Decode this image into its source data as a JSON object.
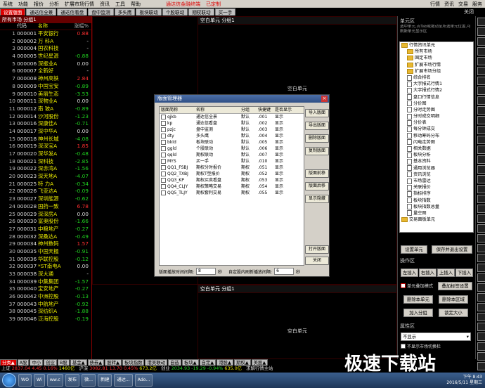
{
  "menubar": {
    "items": [
      "系统",
      "功能",
      "报价",
      "分析",
      "扩展市场行情",
      "资讯",
      "工具",
      "帮助"
    ],
    "alert": "通达信金融终端",
    "alert2": "已定制",
    "right": [
      "行情",
      "资讯",
      "交易",
      "服务"
    ]
  },
  "tabs": [
    "设置版面",
    "通达信全景",
    "通达信看盘",
    "盘中监测",
    "多头鹰",
    "板块联动",
    "个股联动",
    "期权联动",
    "买一手"
  ],
  "close_label": "关闭",
  "stocklist": {
    "header": "所有市场 分组1",
    "col_code": "代码",
    "col_name": "名称",
    "col_chg": "涨幅%",
    "rows": [
      {
        "no": "1",
        "code": "000001",
        "name": "平安银行",
        "chg": "0.88",
        "dir": "up"
      },
      {
        "no": "2",
        "code": "000002",
        "name": "万 科A",
        "chg": "-",
        "dir": "fl"
      },
      {
        "no": "3",
        "code": "000004",
        "name": "国农科技",
        "chg": "-",
        "dir": "fl"
      },
      {
        "no": "4",
        "code": "000005",
        "name": "世纪星源",
        "chg": "-0.88",
        "dir": "dn"
      },
      {
        "no": "5",
        "code": "000006",
        "name": "深振业A",
        "chg": "0.00",
        "dir": "fl"
      },
      {
        "no": "6",
        "code": "000007",
        "name": "全新好",
        "chg": "-",
        "dir": "fl"
      },
      {
        "no": "7",
        "code": "000008",
        "name": "神州高铁",
        "chg": "2.84",
        "dir": "up"
      },
      {
        "no": "8",
        "code": "000009",
        "name": "中国宝安",
        "chg": "-0.89",
        "dir": "dn"
      },
      {
        "no": "9",
        "code": "000010",
        "name": "美丽生态",
        "chg": "-3.53",
        "dir": "dn"
      },
      {
        "no": "10",
        "code": "000011",
        "name": "深物业A",
        "chg": "0.00",
        "dir": "fl"
      },
      {
        "no": "11",
        "code": "000012",
        "name": "南 玻A",
        "chg": "-0.89",
        "dir": "dn"
      },
      {
        "no": "12",
        "code": "000014",
        "name": "沙河股份",
        "chg": "-1.23",
        "dir": "dn"
      },
      {
        "no": "13",
        "code": "000016",
        "name": "深康佳A",
        "chg": "-0.71",
        "dir": "dn"
      },
      {
        "no": "14",
        "code": "000017",
        "name": "深中华A",
        "chg": "0.00",
        "dir": "fl"
      },
      {
        "no": "15",
        "code": "000018",
        "name": "神州长城",
        "chg": "-4.08",
        "dir": "dn"
      },
      {
        "no": "16",
        "code": "000019",
        "name": "深深宝A",
        "chg": "1.85",
        "dir": "up"
      },
      {
        "no": "17",
        "code": "000020",
        "name": "深华发A",
        "chg": "-0.48",
        "dir": "dn"
      },
      {
        "no": "18",
        "code": "000021",
        "name": "深科技",
        "chg": "-2.85",
        "dir": "dn"
      },
      {
        "no": "19",
        "code": "000022",
        "name": "深赤湾A",
        "chg": "-1.56",
        "dir": "dn"
      },
      {
        "no": "20",
        "code": "000023",
        "name": "深天地A",
        "chg": "-4.07",
        "dir": "dn"
      },
      {
        "no": "21",
        "code": "000025",
        "name": "特 力A",
        "chg": "-0.34",
        "dir": "dn"
      },
      {
        "no": "22",
        "code": "000026",
        "name": "飞亚达A",
        "chg": "-0.09",
        "dir": "dn"
      },
      {
        "no": "23",
        "code": "000027",
        "name": "深圳能源",
        "chg": "-0.62",
        "dir": "dn"
      },
      {
        "no": "24",
        "code": "000028",
        "name": "国药一致",
        "chg": "6.78",
        "dir": "up"
      },
      {
        "no": "25",
        "code": "000029",
        "name": "深深房A",
        "chg": "0.00",
        "dir": "fl"
      },
      {
        "no": "26",
        "code": "000030",
        "name": "富奥股份",
        "chg": "-1.66",
        "dir": "dn"
      },
      {
        "no": "27",
        "code": "000031",
        "name": "中粮地产",
        "chg": "-0.27",
        "dir": "dn"
      },
      {
        "no": "28",
        "code": "000032",
        "name": "深桑达A",
        "chg": "-0.49",
        "dir": "dn"
      },
      {
        "no": "29",
        "code": "000034",
        "name": "神州数码",
        "chg": "1.57",
        "dir": "up"
      },
      {
        "no": "30",
        "code": "000035",
        "name": "中国天楹",
        "chg": "-0.91",
        "dir": "dn"
      },
      {
        "no": "31",
        "code": "000036",
        "name": "华联控股",
        "chg": "-0.12",
        "dir": "dn"
      },
      {
        "no": "32",
        "code": "000037",
        "name": "*ST南电A",
        "chg": "0.00",
        "dir": "fl"
      },
      {
        "no": "33",
        "code": "000038",
        "name": "深大通",
        "chg": "-",
        "dir": "fl"
      },
      {
        "no": "34",
        "code": "000039",
        "name": "中集集团",
        "chg": "-1.57",
        "dir": "dn"
      },
      {
        "no": "35",
        "code": "000040",
        "name": "宝安地产",
        "chg": "-0.27",
        "dir": "dn"
      },
      {
        "no": "36",
        "code": "000042",
        "name": "中洲控股",
        "chg": "-0.13",
        "dir": "dn"
      },
      {
        "no": "37",
        "code": "000043",
        "name": "中航地产",
        "chg": "-0.92",
        "dir": "dn"
      },
      {
        "no": "38",
        "code": "000045",
        "name": "深纺织A",
        "chg": "-1.88",
        "dir": "dn"
      },
      {
        "no": "39",
        "code": "000046",
        "name": "泛海控股",
        "chg": "-0.19",
        "dir": "dn"
      }
    ]
  },
  "panes": {
    "top_title": "空白单元 分组1",
    "top_center": "空白单元",
    "bottom_title": "空白单元 分组1",
    "bottom_center": "空白单元"
  },
  "dialog": {
    "title": "版面管理器",
    "headers": [
      "版面简称",
      "名称",
      "分组",
      "快捷键",
      "是否显示"
    ],
    "rows": [
      {
        "short": "qjkb",
        "name": "通达信全景",
        "group": "默认",
        "key": ".001",
        "show": "显示"
      },
      {
        "short": "kp",
        "name": "通达信看盘",
        "group": "默认",
        "key": ".002",
        "show": "显示"
      },
      {
        "short": "pzjc",
        "name": "盘中监测",
        "group": "默认",
        "key": ".003",
        "show": "显示"
      },
      {
        "short": "dty",
        "name": "多头鹰",
        "group": "默认",
        "key": ".004",
        "show": "显示"
      },
      {
        "short": "bkld",
        "name": "板块联动",
        "group": "默认",
        "key": ".005",
        "show": "显示"
      },
      {
        "short": "ggld",
        "name": "个股联动",
        "group": "默认",
        "key": ".006",
        "show": "显示"
      },
      {
        "short": "qqld",
        "name": "期权联动",
        "group": "默认",
        "key": ".007",
        "show": "显示"
      },
      {
        "short": "MYS",
        "name": "买一手",
        "group": "默认",
        "key": ".010",
        "show": "显示"
      },
      {
        "short": "QQ1_FSBJ",
        "name": "期权分时报价",
        "group": "期权",
        "key": ".051",
        "show": "显示"
      },
      {
        "short": "QQ2_TXBJ",
        "name": "期权T型报价",
        "group": "期权",
        "key": ".052",
        "show": "显示"
      },
      {
        "short": "QQ3_KP",
        "name": "期权买卖看盘",
        "group": "期权",
        "key": ".053",
        "show": "显示"
      },
      {
        "short": "QQ4_CLJY",
        "name": "期权策略交易",
        "group": "期权",
        "key": ".054",
        "show": "显示"
      },
      {
        "short": "QQ5_TLJY",
        "name": "期权套利交易",
        "group": "期权",
        "key": ".055",
        "show": "显示"
      }
    ],
    "buttons_top": [
      "导入版面",
      "导出版面",
      "删除版面",
      "复制版面"
    ],
    "buttons_mid": [
      "版面前移",
      "版面后移",
      "显示隐藏"
    ],
    "buttons_bot": [
      "打开版面",
      "关闭"
    ],
    "foot_label1": "版面播放时间间隔:",
    "foot_val1": "8",
    "foot_unit1": "秒",
    "foot_label2": "自定股内刷新播放间隔:",
    "foot_val2": "6",
    "foot_unit2": "秒"
  },
  "rightpanel": {
    "section1": "单元区",
    "hint": "选中单元,点Tab或拖动至所选单元位置,可刷新单元显示区",
    "tree": [
      {
        "label": "行情资讯单元",
        "type": "folder",
        "indent": 0
      },
      {
        "label": "所有市场",
        "type": "folder",
        "indent": 1
      },
      {
        "label": "国定市场",
        "type": "folder",
        "indent": 1
      },
      {
        "label": "扩展市场行情",
        "type": "folder",
        "indent": 1
      },
      {
        "label": "扩展市场分组",
        "type": "folder",
        "indent": 1
      },
      {
        "label": "综合排名",
        "type": "doc",
        "indent": 1
      },
      {
        "label": "大字报式行情1",
        "type": "doc",
        "indent": 1
      },
      {
        "label": "大字报式行情2",
        "type": "doc",
        "indent": 1
      },
      {
        "label": "盘口行情信息",
        "type": "doc",
        "indent": 1
      },
      {
        "label": "分价图",
        "type": "doc",
        "indent": 1
      },
      {
        "label": "分时走势图",
        "type": "doc",
        "indent": 1
      },
      {
        "label": "分时成交明细",
        "type": "doc",
        "indent": 1
      },
      {
        "label": "分价表",
        "type": "doc",
        "indent": 1
      },
      {
        "label": "每分钟成交",
        "type": "doc",
        "indent": 1
      },
      {
        "label": "移动筹码分布",
        "type": "doc",
        "indent": 1
      },
      {
        "label": "闪电走势图",
        "type": "doc",
        "indent": 1
      },
      {
        "label": "相关数据",
        "type": "doc",
        "indent": 1
      },
      {
        "label": "板块分析",
        "type": "doc",
        "indent": 1
      },
      {
        "label": "基本资料",
        "type": "doc",
        "indent": 1
      },
      {
        "label": "通用浏览器",
        "type": "doc",
        "indent": 1
      },
      {
        "label": "资讯浏览",
        "type": "doc",
        "indent": 1
      },
      {
        "label": "市场雷达",
        "type": "doc",
        "indent": 1
      },
      {
        "label": "关联报价",
        "type": "doc",
        "indent": 1
      },
      {
        "label": "指标排序",
        "type": "doc",
        "indent": 1
      },
      {
        "label": "板块指数",
        "type": "doc",
        "indent": 1
      },
      {
        "label": "板块指数总量",
        "type": "doc",
        "indent": 1
      },
      {
        "label": "量空图",
        "type": "doc",
        "indent": 1
      },
      {
        "label": "交易面板单元",
        "type": "folder",
        "indent": 0
      }
    ],
    "btn_set_unit": "设置单元",
    "btn_save_exit": "保存并退出设置",
    "section2": "操作区",
    "ops": [
      "左插入",
      "右插入",
      "上插入",
      "下插入"
    ],
    "chk_overlay": "单元叠加模式",
    "btn_add_tab": "叠加标签设置",
    "btn_del_unit": "删除本单元",
    "btn_del_area": "删除本区域",
    "btn_add_group": "加入分组",
    "btn_lock": "锁定大小",
    "section3": "属性区",
    "select_val": "不显示",
    "chk_hide": "不显示市场切换栏"
  },
  "bottom_tabs": [
    "分类▲",
    "A股",
    "中小",
    "创业",
    "B股",
    "基金▲",
    "债券▲",
    "股转▲",
    "板块指数",
    "港美联动",
    "自选",
    "板块▲",
    "自定▲",
    "港股▲",
    "期权▲",
    "美股▲"
  ],
  "ticker": [
    {
      "label": "上证",
      "val": "2837.04",
      "chg": "4.45",
      "pct": "0.16%",
      "amt": "1460亿",
      "dir": "up"
    },
    {
      "label": "沪深",
      "val": "3082.81",
      "chg": "13.70",
      "pct": "0.45%",
      "amt": "673.2亿",
      "dir": "up"
    },
    {
      "label": "创业",
      "val": "2034.93",
      "chg": "-19.29",
      "pct": "-0.94%",
      "amt": "635.0亿",
      "dir": "dn"
    }
  ],
  "ticker_tail": "求解行情主站",
  "taskbar": [
    "WO",
    "Wi",
    "ww.c",
    "发布",
    "微...",
    "新建",
    "通达...",
    "Ado..."
  ],
  "clock": {
    "time": "下午 8:43",
    "date": "2016/5/11 星期三"
  },
  "watermark": "极速下载站"
}
